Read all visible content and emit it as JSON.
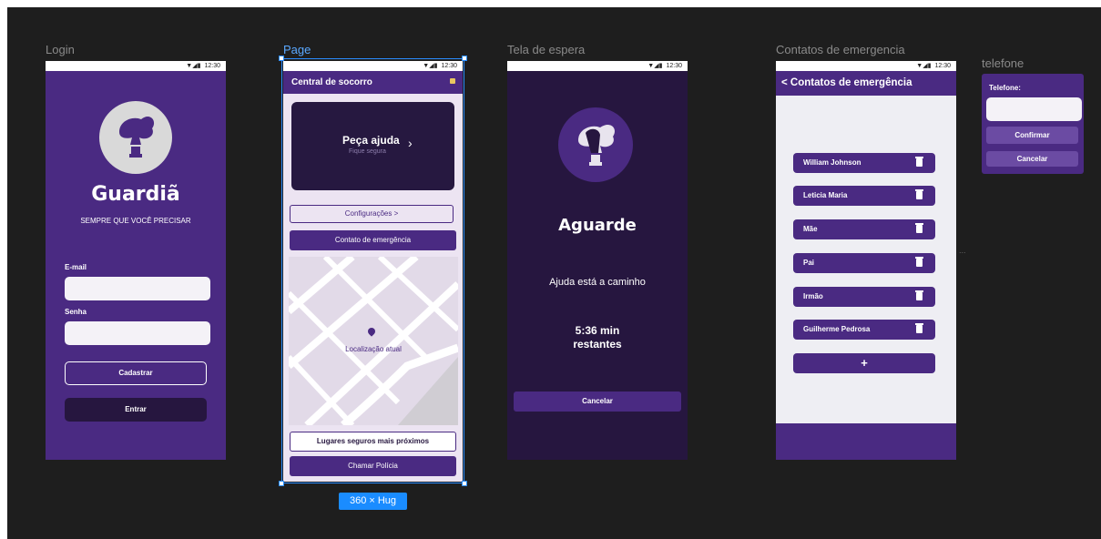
{
  "frames": {
    "login": "Login",
    "page": "Page",
    "wait": "Tela de espera",
    "contacts": "Contatos de emergencia",
    "tel": "telefone"
  },
  "status": {
    "time": "12:30",
    "signal": "▼◢▮"
  },
  "login": {
    "app_name": "Guardiã",
    "tagline": "SEMPRE QUE VOCÊ PRECISAR",
    "email_label": "E-mail",
    "email_value": "",
    "password_label": "Senha",
    "password_value": "",
    "register_button": "Cadastrar",
    "enter_button": "Entrar"
  },
  "page": {
    "title": "Central de socorro",
    "help_title": "Peça ajuda",
    "help_subtitle": "Fique segura",
    "settings_button": "Configurações",
    "emergency_contact_button": "Contato de emergência",
    "map_location_label": "Localização atual",
    "safe_places_button": "Lugares seguros mais próximos",
    "call_police_button": "Chamar Polícia",
    "size_badge": "360 × Hug"
  },
  "wait": {
    "title": "Aguarde",
    "message": "Ajuda está a caminho",
    "time_remaining": "5:36 min",
    "remaining_label": "restantes",
    "cancel_button": "Cancelar"
  },
  "contacts": {
    "title": "Contatos de emergência",
    "items": [
      "William Johnson",
      "Leticia Maria",
      "Mãe",
      "Pai",
      "Irmão",
      "Guilherme Pedrosa"
    ],
    "add_button": "+",
    "ellipsis": "..."
  },
  "tel": {
    "label": "Telefone:",
    "value": "",
    "confirm_button": "Confirmar",
    "cancel_button": "Cancelar"
  },
  "colors": {
    "canvas": "#1e1e1e",
    "primary_purple": "#4a2a82",
    "dark_purple": "#26163f",
    "selection_blue": "#2a8cff"
  }
}
